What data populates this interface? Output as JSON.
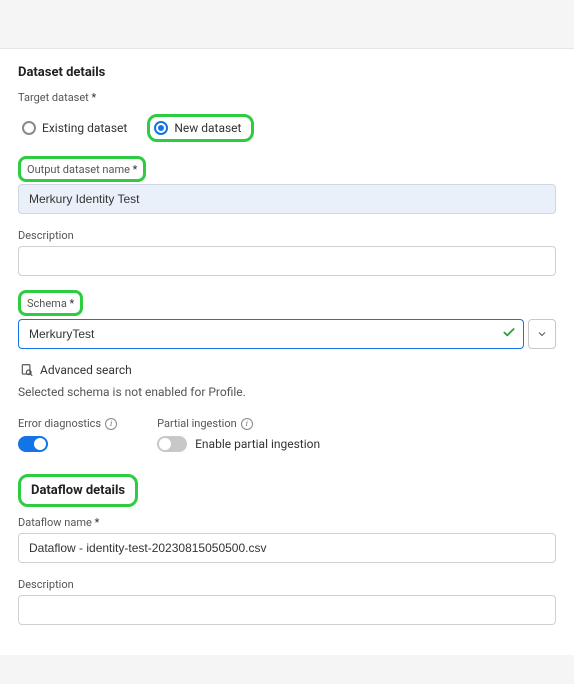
{
  "datasetDetails": {
    "title": "Dataset details",
    "targetDatasetLabel": "Target dataset",
    "existingLabel": "Existing dataset",
    "newLabel": "New dataset",
    "outputNameLabel": "Output dataset name",
    "outputNameValue": "Merkury Identity Test",
    "descriptionLabel": "Description",
    "descriptionValue": "",
    "schemaLabel": "Schema",
    "schemaValue": "MerkuryTest",
    "advancedSearch": "Advanced search",
    "schemaNote": "Selected schema is not enabled for Profile.",
    "errorDiagLabel": "Error diagnostics",
    "partialLabel": "Partial ingestion",
    "enablePartial": "Enable partial ingestion"
  },
  "dataflowDetails": {
    "title": "Dataflow details",
    "nameLabel": "Dataflow name",
    "nameValue": "Dataflow - identity-test-20230815050500.csv",
    "descriptionLabel": "Description",
    "descriptionValue": ""
  }
}
